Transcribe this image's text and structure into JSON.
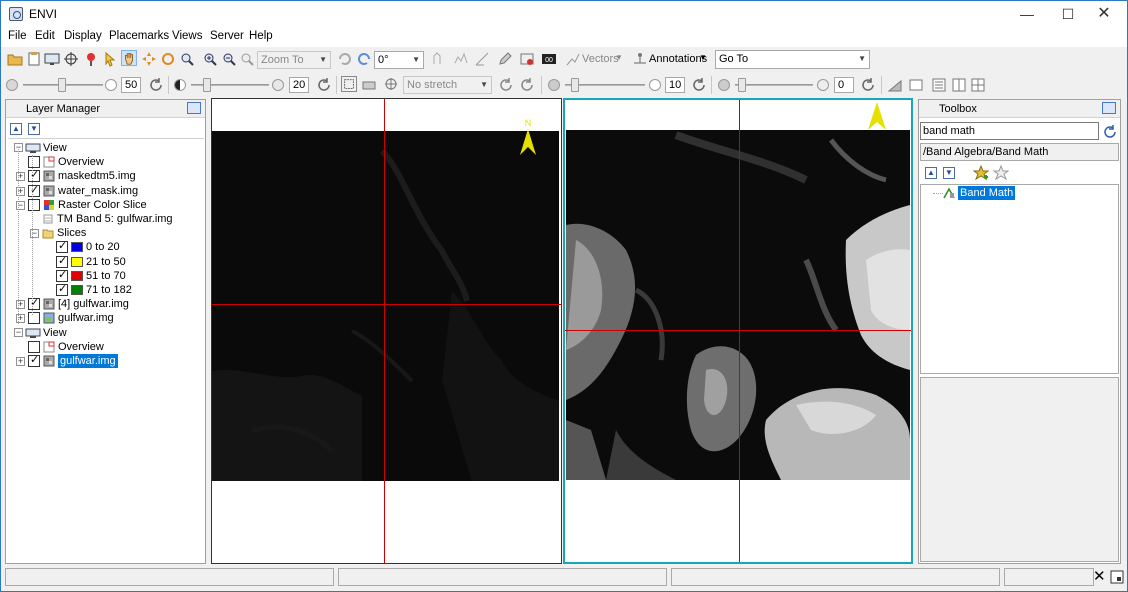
{
  "app": {
    "title": "ENVI"
  },
  "menu": [
    "File",
    "Edit",
    "Display",
    "Placemarks",
    "Views",
    "Server",
    "Help"
  ],
  "toolbar1": {
    "zoom_combo": "Zoom To",
    "rotation_combo": "0°",
    "vectors_label": "Vectors",
    "annotations_label": "Annotations",
    "goto_combo": "Go To"
  },
  "toolbar2": {
    "brightness_value": "50",
    "contrast_value": "20",
    "stretch_combo": "No stretch",
    "sharpen_value": "10",
    "transparency_value": "0"
  },
  "layer_manager": {
    "title": "Layer Manager",
    "tree": [
      {
        "label": "View",
        "level": 0,
        "type": "view"
      },
      {
        "label": "Overview",
        "level": 1,
        "type": "overview",
        "checked": false
      },
      {
        "label": "maskedtm5.img",
        "level": 1,
        "type": "raster",
        "checked": true
      },
      {
        "label": "water_mask.img",
        "level": 1,
        "type": "raster",
        "checked": true
      },
      {
        "label": "Raster Color Slice",
        "level": 1,
        "type": "colorslice",
        "checked": false
      },
      {
        "label": "TM Band 5: gulfwar.img",
        "level": 2,
        "type": "band"
      },
      {
        "label": "Slices",
        "level": 2,
        "type": "folder"
      },
      {
        "label": "0 to 20",
        "level": 3,
        "type": "slice",
        "checked": true,
        "color": "#0000e0"
      },
      {
        "label": "21 to 50",
        "level": 3,
        "type": "slice",
        "checked": true,
        "color": "#ffff00"
      },
      {
        "label": "51 to 70",
        "level": 3,
        "type": "slice",
        "checked": true,
        "color": "#e00000"
      },
      {
        "label": "71 to 182",
        "level": 3,
        "type": "slice",
        "checked": true,
        "color": "#008000"
      },
      {
        "label": "[4] gulfwar.img",
        "level": 1,
        "type": "raster",
        "checked": true
      },
      {
        "label": "gulfwar.img",
        "level": 1,
        "type": "rastercolor",
        "checked": false
      },
      {
        "label": "View",
        "level": 0,
        "type": "view"
      },
      {
        "label": "Overview",
        "level": 1,
        "type": "overview",
        "checked": false
      },
      {
        "label": "gulfwar.img",
        "level": 1,
        "type": "raster",
        "checked": true,
        "selected": true
      }
    ]
  },
  "toolbox": {
    "title": "Toolbox",
    "search_value": "band math",
    "path": "/Band Algebra/Band Math",
    "result": "Band Math"
  },
  "views": {
    "north_label": "N",
    "active_border_color": "#1aa7b5",
    "crosshair_color": "#d00000"
  }
}
